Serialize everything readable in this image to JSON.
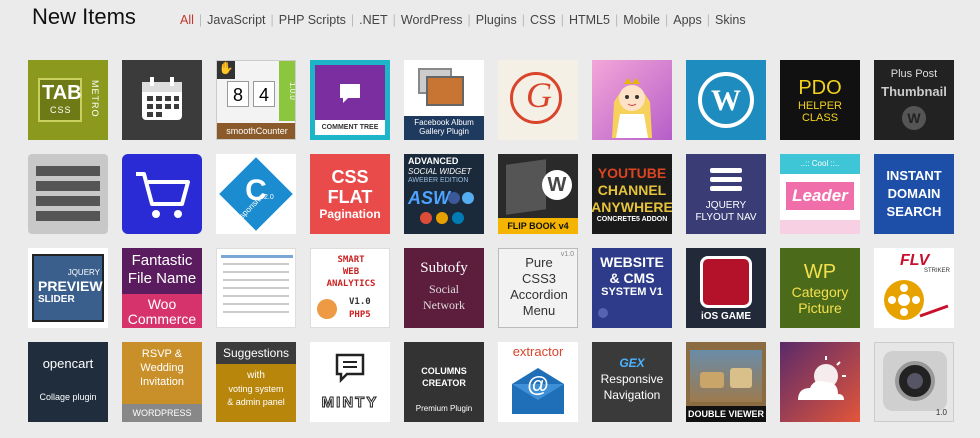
{
  "page_title": "New Items",
  "filters": [
    {
      "label": "All",
      "active": true
    },
    {
      "label": "JavaScript"
    },
    {
      "label": "PHP Scripts"
    },
    {
      "label": ".NET"
    },
    {
      "label": "WordPress"
    },
    {
      "label": "Plugins"
    },
    {
      "label": "CSS"
    },
    {
      "label": "HTML5"
    },
    {
      "label": "Mobile"
    },
    {
      "label": "Apps"
    },
    {
      "label": "Skins"
    }
  ],
  "tiles": {
    "tab": {
      "t1": "TAB",
      "t2": "CSS",
      "t3": "METRO"
    },
    "counter": {
      "d1": "8",
      "d2": "4",
      "ver": "1.0.0",
      "label": "smoothCounter"
    },
    "comment": {
      "label": "COMMENT TREE"
    },
    "fbalbum": {
      "l1": "Facebook Album",
      "l2": "Gallery Plugin"
    },
    "letter_g": {
      "glyph": "G"
    },
    "pdo": {
      "l1": "PDO",
      "l2": "HELPER",
      "l3": "CLASS"
    },
    "pluspost": {
      "l1": "Plus Post",
      "l2": "Thumbnail"
    },
    "responsive_c": {
      "letter": "C",
      "ver": "2.0",
      "word": "responsive"
    },
    "cssflat": {
      "l1": "CSS",
      "l2": "FLAT",
      "l3": "Pagination"
    },
    "social": {
      "l1": "ADVANCED",
      "l2": "SOCIAL WIDGET",
      "l3": "AWEBER EDITION",
      "l4": "ASW"
    },
    "flipbook": {
      "label": "FLIP BOOK v4"
    },
    "youtube": {
      "l1": "YOUTUBE",
      "l2": "CHANNEL",
      "l3": "ANYWHERE",
      "l4": "CONCRETE5 ADDON"
    },
    "flyout": {
      "l1": "JQUERY",
      "l2": "FLYOUT NAV"
    },
    "leader": {
      "top": "..:: Cool ::..",
      "word": "Leader"
    },
    "instant": {
      "l1": "INSTANT",
      "l2": "DOMAIN",
      "l3": "SEARCH"
    },
    "preview": {
      "l1": "JQUERY",
      "l2": "PREVIEW",
      "l3": "SLIDER"
    },
    "fantastic": {
      "l1": "Fantastic",
      "l2": "File Name",
      "l3": "Woo",
      "l4": "Commerce"
    },
    "smartweb": {
      "l1": "SMART",
      "l2": "WEB",
      "l3": "ANALYTICS",
      "l4": "V1.0",
      "l5": "PHP5"
    },
    "subtofy": {
      "l1": "Subtofy",
      "l2": "Social",
      "l3": "Network"
    },
    "purecss": {
      "ver": "v1.0",
      "l1": "Pure",
      "l2": "CSS3",
      "l3": "Accordion",
      "l4": "Menu"
    },
    "cmsweb": {
      "l1": "WEBSITE",
      "l2": "& CMS",
      "l3": "SYSTEM V1"
    },
    "iosgame": {
      "label": "iOS GAME"
    },
    "wpcat": {
      "l1": "WP",
      "l2": "Category",
      "l3": "Picture"
    },
    "flv": {
      "word": "FLV",
      "sub": "STRIKER"
    },
    "opencart": {
      "l1": "opencart",
      "l2": "Collage plugin"
    },
    "rsvp": {
      "l1": "RSVP &",
      "l2": "Wedding",
      "l3": "Invitation",
      "l4": "WORDPRESS"
    },
    "suggest": {
      "l1": "Suggestions",
      "l2": "with",
      "l3": "voting system",
      "l4": "& admin panel"
    },
    "minty": {
      "word": "MINTY"
    },
    "columns": {
      "l1": "COLUMNS",
      "l2": "CREATOR",
      "l3": "Premium Plugin"
    },
    "extractor": {
      "word": "extractor",
      "at": "@"
    },
    "gex": {
      "l1": "GEX",
      "l2": "Responsive",
      "l3": "Navigation"
    },
    "double": {
      "label": "DOUBLE VIEWER"
    },
    "camera": {
      "ver": "1.0"
    }
  }
}
